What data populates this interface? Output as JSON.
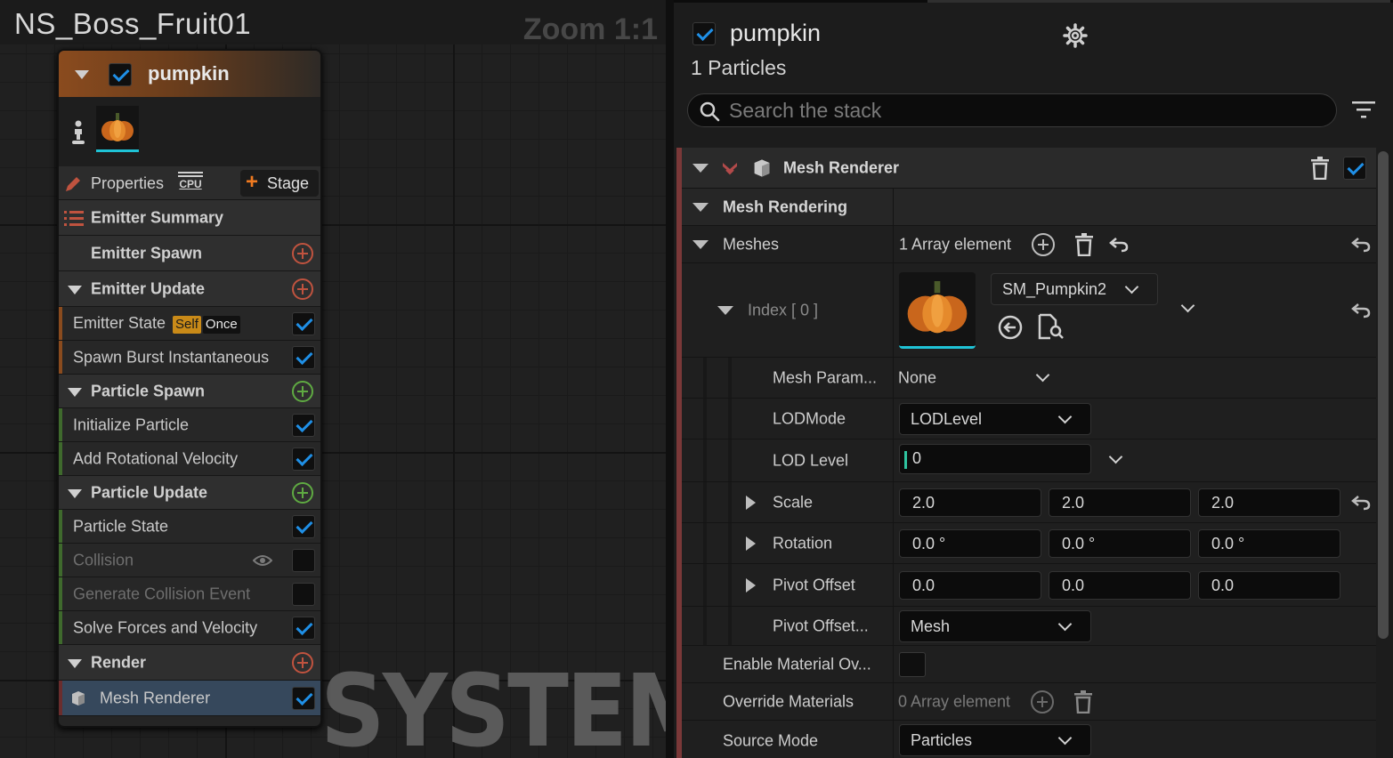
{
  "graph": {
    "title": "NS_Boss_Fruit01",
    "zoom_label": "Zoom 1:1",
    "watermark": "SYSTEM"
  },
  "node": {
    "name": "pumpkin",
    "enabled": true,
    "properties_label": "Properties",
    "cpu_label": "CPU",
    "stage_label": "Stage",
    "rows": [
      {
        "label": "Emitter Summary",
        "kind": "summary"
      },
      {
        "label": "Emitter Spawn",
        "kind": "section"
      },
      {
        "label": "Emitter Update",
        "kind": "section"
      },
      {
        "label": "Emitter State",
        "kind": "module",
        "badge_self": "Self",
        "badge_once": "Once",
        "enabled": true
      },
      {
        "label": "Spawn Burst Instantaneous",
        "kind": "module",
        "enabled": true
      },
      {
        "label": "Particle Spawn",
        "kind": "section"
      },
      {
        "label": "Initialize Particle",
        "kind": "module",
        "enabled": true
      },
      {
        "label": "Add Rotational Velocity",
        "kind": "module",
        "enabled": true
      },
      {
        "label": "Particle Update",
        "kind": "section"
      },
      {
        "label": "Particle State",
        "kind": "module",
        "enabled": true
      },
      {
        "label": "Collision",
        "kind": "module",
        "enabled": false
      },
      {
        "label": "Generate Collision Event",
        "kind": "module",
        "enabled": false
      },
      {
        "label": "Solve Forces and Velocity",
        "kind": "module",
        "enabled": true
      },
      {
        "label": "Render",
        "kind": "section"
      },
      {
        "label": "Mesh Renderer",
        "kind": "renderer",
        "enabled": true
      }
    ]
  },
  "details": {
    "emitter_name": "pumpkin",
    "enabled": true,
    "particles_label": "1 Particles",
    "search_placeholder": "Search the stack",
    "renderer": {
      "title": "Mesh Renderer",
      "enabled": true,
      "group_label": "Mesh Rendering",
      "meshes_label": "Meshes",
      "meshes_count": "1 Array element",
      "index_label": "Index [ 0 ]",
      "mesh_asset": "SM_Pumpkin2",
      "mesh_param_label": "Mesh Param...",
      "mesh_param_value": "None",
      "lodmode_label": "LODMode",
      "lodmode_value": "LODLevel",
      "lod_level_label": "LOD Level",
      "lod_level_value": "0",
      "scale_label": "Scale",
      "scale": [
        "2.0",
        "2.0",
        "2.0"
      ],
      "rotation_label": "Rotation",
      "rotation": [
        "0.0 °",
        "0.0 °",
        "0.0 °"
      ],
      "pivot_offset_label": "Pivot Offset",
      "pivot_offset": [
        "0.0",
        "0.0",
        "0.0"
      ],
      "pivot_space_label": "Pivot Offset...",
      "pivot_space_value": "Mesh",
      "enable_material_label": "Enable Material Ov...",
      "override_materials_label": "Override Materials",
      "override_materials_count": "0 Array element",
      "source_mode_label": "Source Mode",
      "source_mode_value": "Particles"
    }
  },
  "colors": {
    "accent_blue": "#1f8fe6",
    "emitter_orange": "#8a4b1e",
    "particle_green": "#5faa42",
    "section_red": "#c0533f",
    "thumb_underline": "#1fc3d6"
  }
}
